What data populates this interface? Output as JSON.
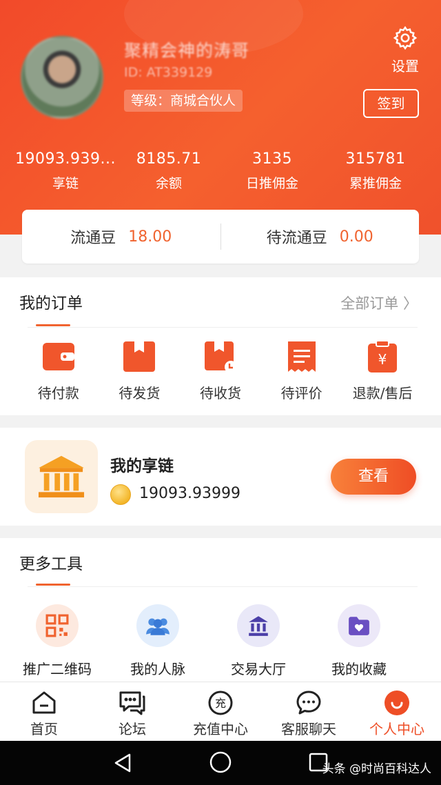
{
  "profile": {
    "nickname": "聚精会神的涛哥",
    "id_text": "ID: AT339129",
    "level_text": "等级：商城合伙人",
    "settings_label": "设置",
    "checkin_label": "签到"
  },
  "stats": [
    {
      "value": "19093.939...",
      "label": "享链"
    },
    {
      "value": "8185.71",
      "label": "余额"
    },
    {
      "value": "3135",
      "label": "日推佣金"
    },
    {
      "value": "315781",
      "label": "累推佣金"
    }
  ],
  "beans": {
    "circulating_label": "流通豆",
    "circulating_value": "18.00",
    "pending_label": "待流通豆",
    "pending_value": "0.00"
  },
  "orders": {
    "title": "我的订单",
    "all_link": "全部订单 〉",
    "items": [
      {
        "label": "待付款",
        "icon": "wallet-icon"
      },
      {
        "label": "待发货",
        "icon": "box-icon"
      },
      {
        "label": "待收货",
        "icon": "box-receive-icon"
      },
      {
        "label": "待评价",
        "icon": "receipt-icon"
      },
      {
        "label": "退款/售后",
        "icon": "refund-icon"
      }
    ]
  },
  "chain": {
    "title": "我的享链",
    "value": "19093.93999",
    "view_label": "查看"
  },
  "tools": {
    "title": "更多工具",
    "items": [
      {
        "label": "推广二维码",
        "icon": "qrcode-icon"
      },
      {
        "label": "我的人脉",
        "icon": "people-icon"
      },
      {
        "label": "交易大厅",
        "icon": "bank-icon"
      },
      {
        "label": "我的收藏",
        "icon": "folder-heart-icon"
      }
    ]
  },
  "tabs": [
    {
      "label": "首页",
      "icon": "home-icon"
    },
    {
      "label": "论坛",
      "icon": "forum-icon"
    },
    {
      "label": "充值中心",
      "icon": "recharge-icon",
      "icon_glyph": "充"
    },
    {
      "label": "客服聊天",
      "icon": "chat-icon"
    },
    {
      "label": "个人中心",
      "icon": "profile-icon",
      "active": true
    }
  ],
  "watermark": "头条 @时尚百科达人",
  "colors": {
    "accent": "#f0632f",
    "header": "#f24a2a",
    "active_tab": "#ee4e26"
  }
}
